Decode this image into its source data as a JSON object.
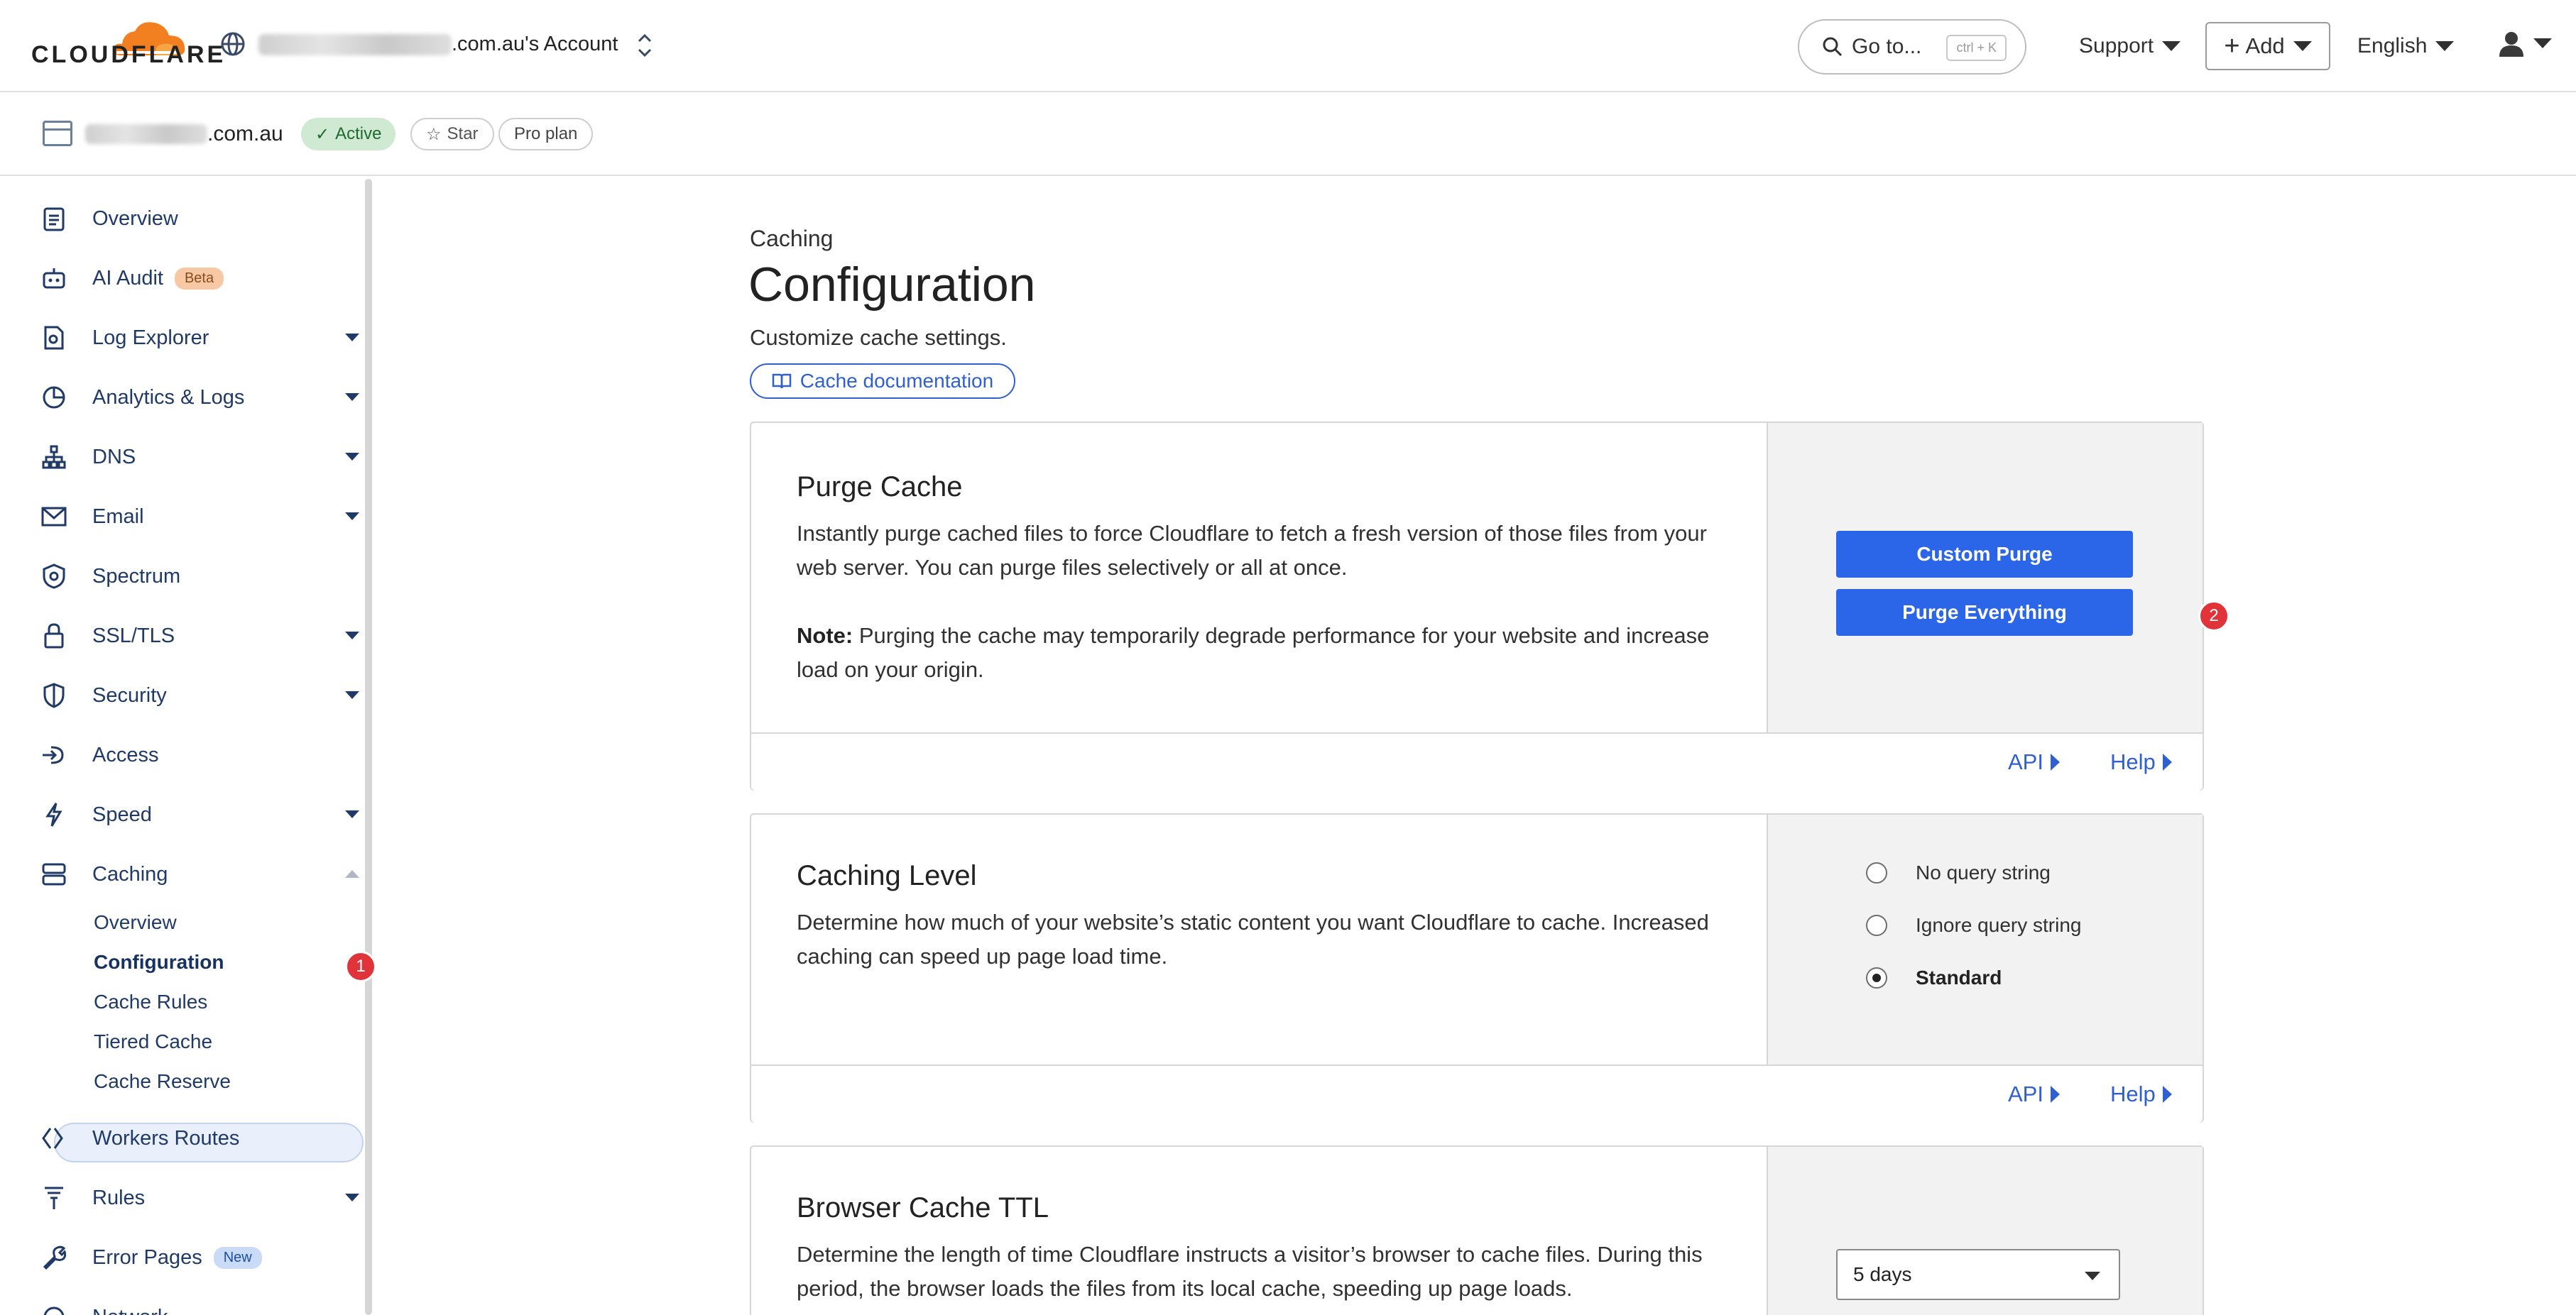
{
  "header": {
    "logo_text": "CLOUDFLARE",
    "account_suffix": ".com.au's Account",
    "goto_label": "Go to...",
    "goto_shortcut": "ctrl + K",
    "support_label": "Support",
    "add_label": "Add",
    "language_label": "English",
    "accent_color": "#f38020"
  },
  "zone": {
    "name_suffix": ".com.au",
    "status": "Active",
    "star_label": "Star",
    "plan": "Pro plan"
  },
  "sidebar": {
    "items": [
      {
        "label": "Overview",
        "icon": "clipboard-icon"
      },
      {
        "label": "AI Audit",
        "icon": "robot-icon",
        "badge": "Beta"
      },
      {
        "label": "Log Explorer",
        "icon": "log-file-icon"
      },
      {
        "label": "Analytics & Logs",
        "icon": "pie-chart-icon"
      },
      {
        "label": "DNS",
        "icon": "network-icon"
      },
      {
        "label": "Email",
        "icon": "envelope-icon"
      },
      {
        "label": "Spectrum",
        "icon": "shield-gear-icon"
      },
      {
        "label": "SSL/TLS",
        "icon": "lock-icon"
      },
      {
        "label": "Security",
        "icon": "shield-icon"
      },
      {
        "label": "Access",
        "icon": "access-arrow-icon"
      },
      {
        "label": "Speed",
        "icon": "lightning-icon"
      },
      {
        "label": "Caching",
        "icon": "server-stack-icon"
      },
      {
        "label": "Workers Routes",
        "icon": "workers-icon"
      },
      {
        "label": "Rules",
        "icon": "funnel-icon"
      },
      {
        "label": "Error Pages",
        "icon": "wrench-icon",
        "badge": "New"
      },
      {
        "label": "Network",
        "icon": "network-pin-icon"
      }
    ],
    "caching_sub": [
      "Overview",
      "Configuration",
      "Cache Rules",
      "Tiered Cache",
      "Cache Reserve"
    ],
    "annotation_1": "1"
  },
  "main": {
    "breadcrumb": "Caching",
    "title": "Configuration",
    "subtitle": "Customize cache settings.",
    "doc_button": "Cache documentation",
    "purge": {
      "heading": "Purge Cache",
      "description": "Instantly purge cached files to force Cloudflare to fetch a fresh version of those files from your web server. You can purge files selectively or all at once.",
      "note_label": "Note:",
      "note_text": " Purging the cache may temporarily degrade performance for your website and increase load on your origin.",
      "custom_purge": "Custom Purge",
      "purge_everything": "Purge Everything",
      "annotation_2": "2"
    },
    "caching_level": {
      "heading": "Caching Level",
      "description": "Determine how much of your website’s static content you want Cloudflare to cache. Increased caching can speed up page load time.",
      "options": [
        "No query string",
        "Ignore query string",
        "Standard"
      ],
      "selected": "Standard"
    },
    "browser_ttl": {
      "heading": "Browser Cache TTL",
      "description": "Determine the length of time Cloudflare instructs a visitor’s browser to cache files. During this period, the browser loads the files from its local cache, speeding up page loads.",
      "value": "5 days"
    },
    "footer_links": {
      "api": "API",
      "help": "Help"
    }
  }
}
